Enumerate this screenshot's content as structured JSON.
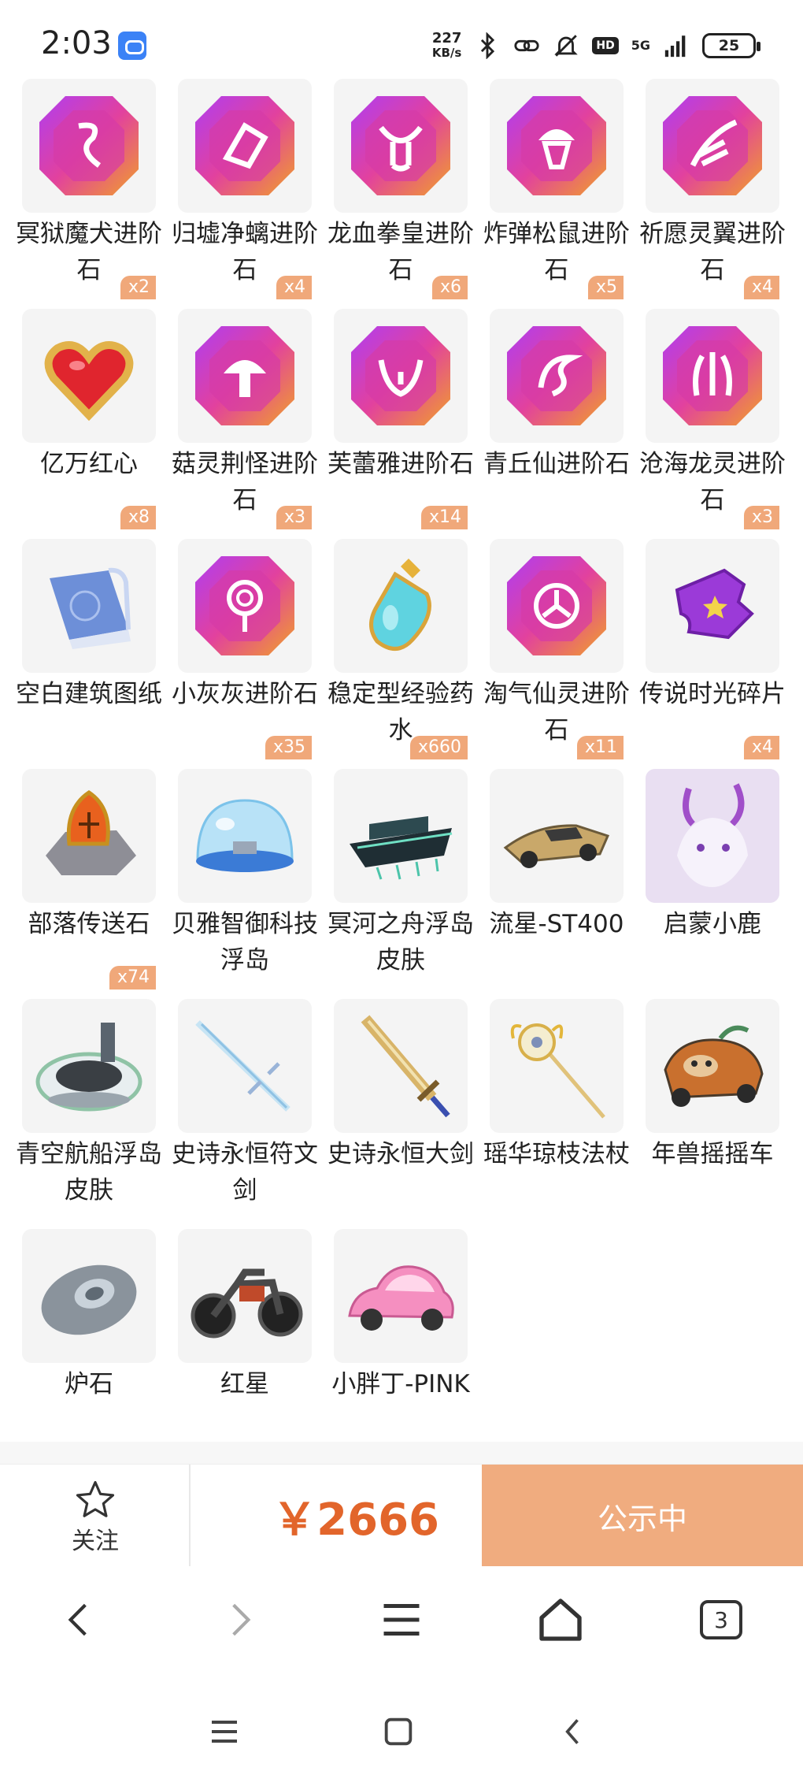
{
  "status_bar": {
    "time": "2:03",
    "speed_value": "227",
    "speed_unit": "KB/s",
    "hd": "HD",
    "network": "5G",
    "battery": "25"
  },
  "items": [
    {
      "name": "冥狱魔犬进阶石",
      "qty": "x2",
      "icon": "purple-gem-icon"
    },
    {
      "name": "归墟净螭进阶石",
      "qty": "x4",
      "icon": "purple-gem-icon"
    },
    {
      "name": "龙血拳皇进阶石",
      "qty": "x6",
      "icon": "purple-gem-icon"
    },
    {
      "name": "炸弹松鼠进阶石",
      "qty": "x5",
      "icon": "purple-gem-icon"
    },
    {
      "name": "祈愿灵翼进阶石",
      "qty": "x4",
      "icon": "purple-gem-icon"
    },
    {
      "name": "亿万红心",
      "qty": "x8",
      "icon": "red-heart-icon"
    },
    {
      "name": "菇灵荆怪进阶石",
      "qty": "x3",
      "icon": "purple-gem-icon"
    },
    {
      "name": "芙蕾雅进阶石",
      "qty": "x14",
      "icon": "purple-gem-icon"
    },
    {
      "name": "青丘仙进阶石",
      "qty": "",
      "icon": "purple-gem-icon"
    },
    {
      "name": "沧海龙灵进阶石",
      "qty": "x3",
      "icon": "purple-gem-icon"
    },
    {
      "name": "空白建筑图纸",
      "qty": "",
      "icon": "blueprint-scroll-icon"
    },
    {
      "name": "小灰灰进阶石",
      "qty": "x35",
      "icon": "purple-gem-icon"
    },
    {
      "name": "稳定型经验药水",
      "qty": "x660",
      "icon": "potion-bottle-icon"
    },
    {
      "name": "淘气仙灵进阶石",
      "qty": "x11",
      "icon": "purple-gem-icon"
    },
    {
      "name": "传说时光碎片",
      "qty": "x4",
      "icon": "puzzle-shard-icon"
    },
    {
      "name": "部落传送石",
      "qty": "x74",
      "icon": "teleport-stone-icon"
    },
    {
      "name": "贝雅智御科技浮岛",
      "qty": "",
      "icon": "dome-island-icon"
    },
    {
      "name": "冥河之舟浮岛皮肤",
      "qty": "",
      "icon": "ghost-ship-icon"
    },
    {
      "name": "流星-ST400",
      "qty": "",
      "icon": "kart-icon"
    },
    {
      "name": "启蒙小鹿",
      "qty": "",
      "icon": "deer-pet-icon"
    },
    {
      "name": "青空航船浮岛皮肤",
      "qty": "",
      "icon": "stadium-island-icon"
    },
    {
      "name": "史诗永恒符文剑",
      "qty": "",
      "icon": "rune-sword-icon"
    },
    {
      "name": "史诗永恒大剑",
      "qty": "",
      "icon": "great-sword-icon"
    },
    {
      "name": "瑶华琼枝法杖",
      "qty": "",
      "icon": "staff-icon"
    },
    {
      "name": "年兽摇摇车",
      "qty": "",
      "icon": "beast-car-icon"
    },
    {
      "name": "炉石",
      "qty": "",
      "icon": "hearthstone-icon"
    },
    {
      "name": "红星",
      "qty": "",
      "icon": "motorcycle-icon"
    },
    {
      "name": "小胖丁-PINK",
      "qty": "",
      "icon": "pink-beetle-car-icon"
    }
  ],
  "action_bar": {
    "follow_label": "关注",
    "price": "￥2666",
    "status_button": "公示中"
  },
  "browser_nav": {
    "tab_count": "3"
  },
  "colors": {
    "accent_orange": "#e2652b",
    "button_peach": "#f0ac7f",
    "badge_bg": "#f0a87a",
    "tile_bg": "#f4f4f4"
  }
}
